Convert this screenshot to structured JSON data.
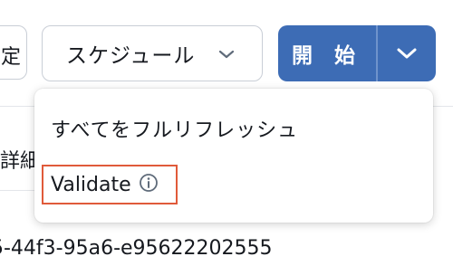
{
  "toolbar": {
    "partial_button_char": "定",
    "schedule_label": "スケジュール",
    "start_label": "開 始"
  },
  "dropdown": {
    "items": [
      {
        "label": "すべてをフルリフレッシュ"
      },
      {
        "label": "Validate",
        "icon": "info-circle-icon",
        "highlighted": true
      }
    ]
  },
  "background": {
    "tab_partial": "詳細",
    "id_text": "5-44f3-95a6-e95622202555"
  },
  "colors": {
    "primary": "#3d6cb5",
    "highlight_border": "#e05a3a",
    "border": "#c9ced6"
  }
}
